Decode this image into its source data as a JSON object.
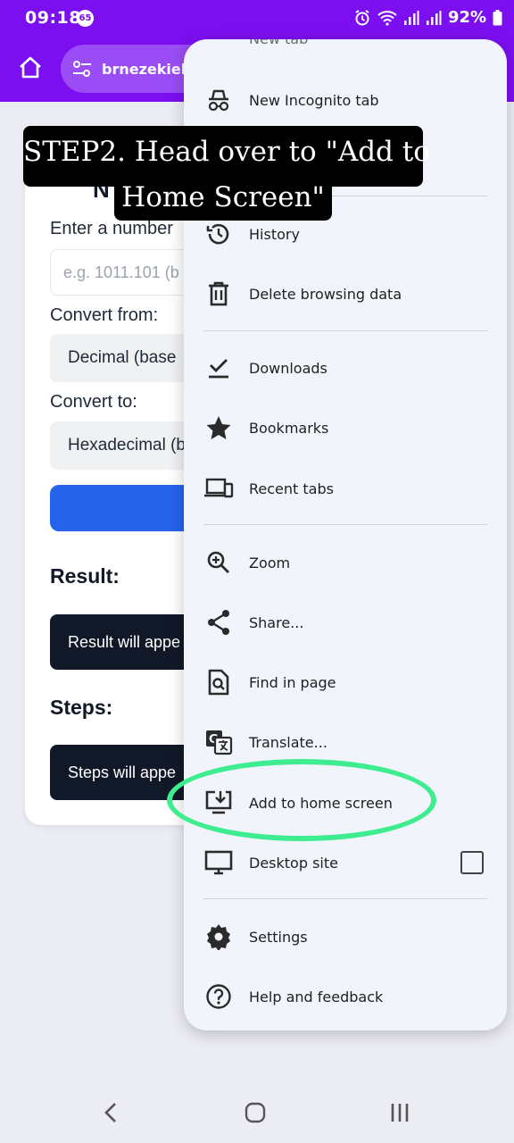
{
  "status_bar": {
    "time": "09:18",
    "notification_count": "65",
    "battery": "92%",
    "background_color": "#7b0ff0"
  },
  "toolbar": {
    "url": "brnezekiel.gi",
    "home_icon": "home-icon",
    "site_settings_icon": "tune-icon"
  },
  "page": {
    "title_fragment": "N",
    "number_label": "Enter a number",
    "number_placeholder": "e.g. 1011.101 (b",
    "from_label": "Convert from:",
    "from_value": "Decimal (base",
    "to_label": "Convert to:",
    "to_value": "Hexadecimal (b",
    "button_color": "#2563eb",
    "result_heading": "Result:",
    "result_text": "Result will appe",
    "steps_heading": "Steps:",
    "steps_text": "Steps will appe"
  },
  "menu": {
    "partial_top_item": "New tab",
    "items": [
      {
        "label": "New Incognito tab",
        "icon": "incognito-icon"
      },
      {
        "label": "History",
        "icon": "history-icon"
      },
      {
        "label": "Delete browsing data",
        "icon": "trash-icon"
      },
      {
        "label": "Downloads",
        "icon": "download-icon"
      },
      {
        "label": "Bookmarks",
        "icon": "star-icon"
      },
      {
        "label": "Recent tabs",
        "icon": "devices-icon"
      },
      {
        "label": "Zoom",
        "icon": "zoom-in-icon"
      },
      {
        "label": "Share...",
        "icon": "share-icon"
      },
      {
        "label": "Find in page",
        "icon": "find-in-page-icon"
      },
      {
        "label": "Translate...",
        "icon": "translate-icon"
      },
      {
        "label": "Add to home screen",
        "icon": "add-to-home-screen-icon"
      },
      {
        "label": "Desktop site",
        "icon": "desktop-icon",
        "checked": false
      },
      {
        "label": "Settings",
        "icon": "gear-icon"
      },
      {
        "label": "Help and feedback",
        "icon": "help-icon"
      }
    ]
  },
  "tutorial": {
    "caption_line1": "STEP2. Head over to \"Add to",
    "caption_line2": "Home Screen\"",
    "highlight_color": "#3ded8f"
  },
  "nav_bar": {
    "back_icon": "back-icon",
    "home_icon": "home-circle-icon",
    "recents_icon": "recents-icon"
  }
}
